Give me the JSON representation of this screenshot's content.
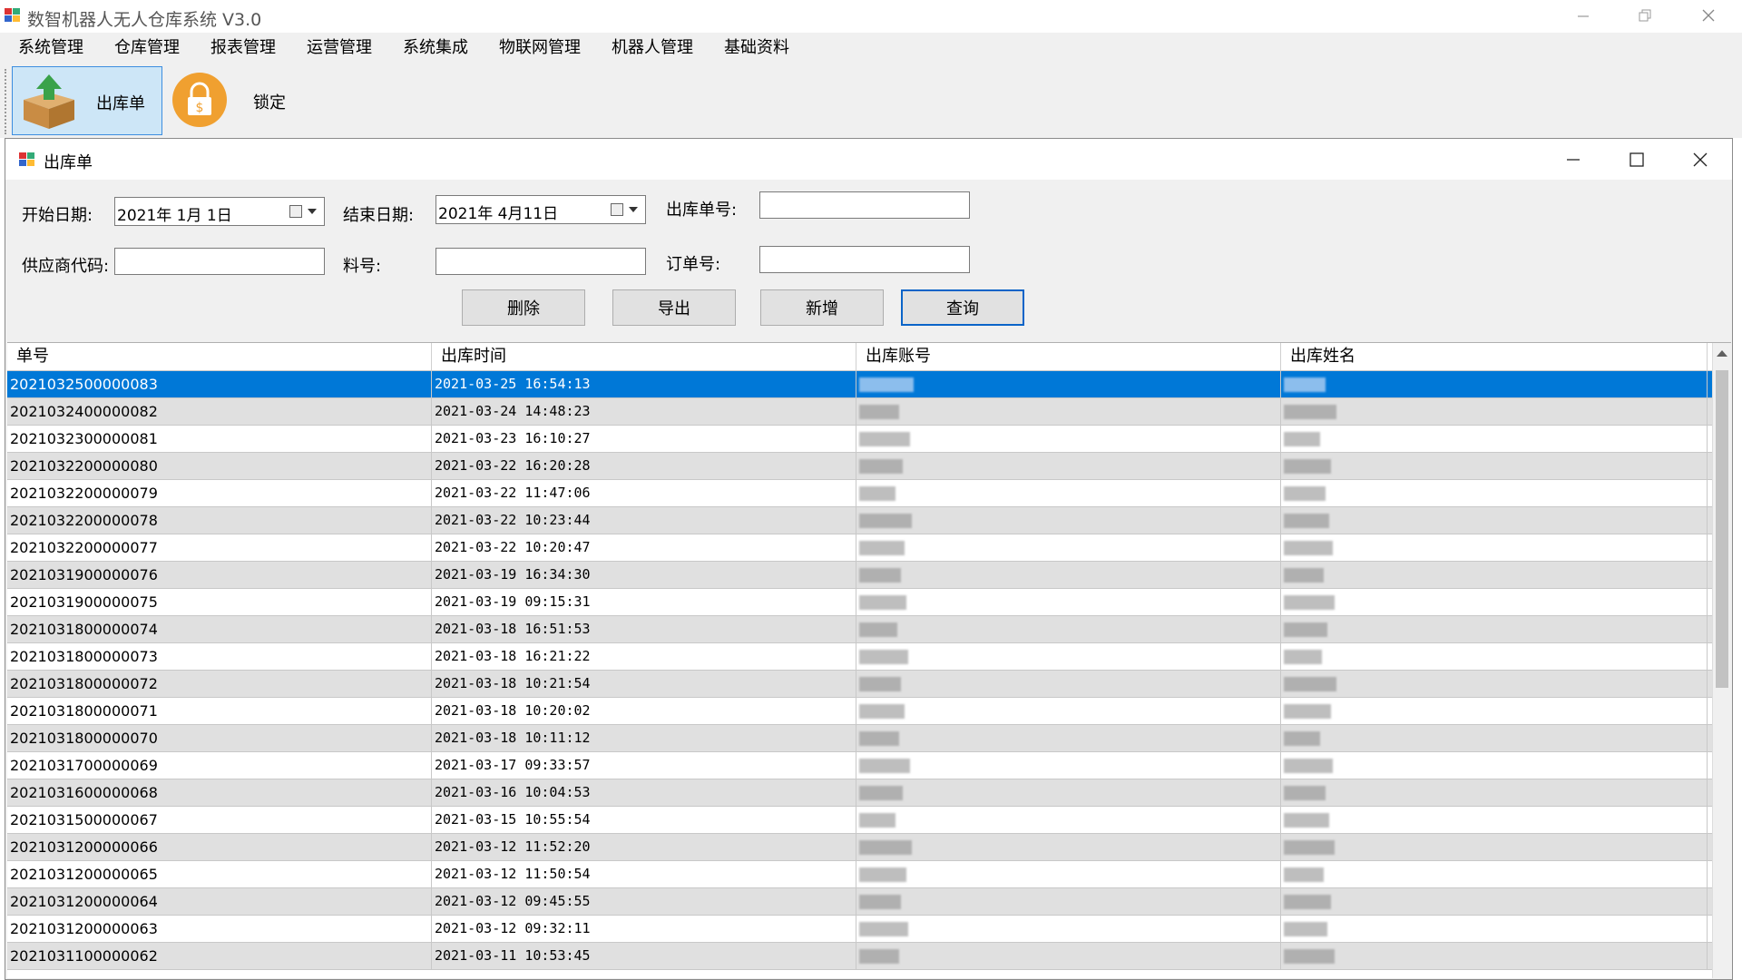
{
  "app": {
    "title": "数智机器人无人仓库系统 V3.0"
  },
  "menu": [
    "系统管理",
    "仓库管理",
    "报表管理",
    "运营管理",
    "系统集成",
    "物联网管理",
    "机器人管理",
    "基础资料"
  ],
  "toolbar": {
    "outbound_label": "出库单",
    "lock_label": "锁定"
  },
  "window": {
    "title": "出库单"
  },
  "filters": {
    "start_date_label": "开始日期:",
    "start_date_value": "2021年 1月 1日",
    "end_date_label": "结束日期:",
    "end_date_value": "2021年 4月11日",
    "order_no_label": "出库单号:",
    "supplier_label": "供应商代码:",
    "part_label": "料号:",
    "po_label": "订单号:"
  },
  "buttons": {
    "delete": "删除",
    "export": "导出",
    "add": "新增",
    "query": "查询"
  },
  "grid": {
    "headers": [
      "单号",
      "出库时间",
      "出库账号",
      "出库姓名"
    ],
    "rows": [
      {
        "no": "2021032500000083",
        "time": "2021-03-25 16:54:13"
      },
      {
        "no": "2021032400000082",
        "time": "2021-03-24 14:48:23"
      },
      {
        "no": "2021032300000081",
        "time": "2021-03-23 16:10:27"
      },
      {
        "no": "2021032200000080",
        "time": "2021-03-22 16:20:28"
      },
      {
        "no": "2021032200000079",
        "time": "2021-03-22 11:47:06"
      },
      {
        "no": "2021032200000078",
        "time": "2021-03-22 10:23:44"
      },
      {
        "no": "2021032200000077",
        "time": "2021-03-22 10:20:47"
      },
      {
        "no": "2021031900000076",
        "time": "2021-03-19 16:34:30"
      },
      {
        "no": "2021031900000075",
        "time": "2021-03-19 09:15:31"
      },
      {
        "no": "2021031800000074",
        "time": "2021-03-18 16:51:53"
      },
      {
        "no": "2021031800000073",
        "time": "2021-03-18 16:21:22"
      },
      {
        "no": "2021031800000072",
        "time": "2021-03-18 10:21:54"
      },
      {
        "no": "2021031800000071",
        "time": "2021-03-18 10:20:02"
      },
      {
        "no": "2021031800000070",
        "time": "2021-03-18 10:11:12"
      },
      {
        "no": "2021031700000069",
        "time": "2021-03-17 09:33:57"
      },
      {
        "no": "2021031600000068",
        "time": "2021-03-16 10:04:53"
      },
      {
        "no": "2021031500000067",
        "time": "2021-03-15 10:55:54"
      },
      {
        "no": "2021031200000066",
        "time": "2021-03-12 11:52:20"
      },
      {
        "no": "2021031200000065",
        "time": "2021-03-12 11:50:54"
      },
      {
        "no": "2021031200000064",
        "time": "2021-03-12 09:45:55"
      },
      {
        "no": "2021031200000063",
        "time": "2021-03-12 09:32:11"
      },
      {
        "no": "2021031100000062",
        "time": "2021-03-11 10:53:45"
      }
    ]
  },
  "colors": {
    "selection": "#0078d7",
    "toolbar_active_bg": "#cde6f7",
    "lock_icon": "#f0a030"
  }
}
